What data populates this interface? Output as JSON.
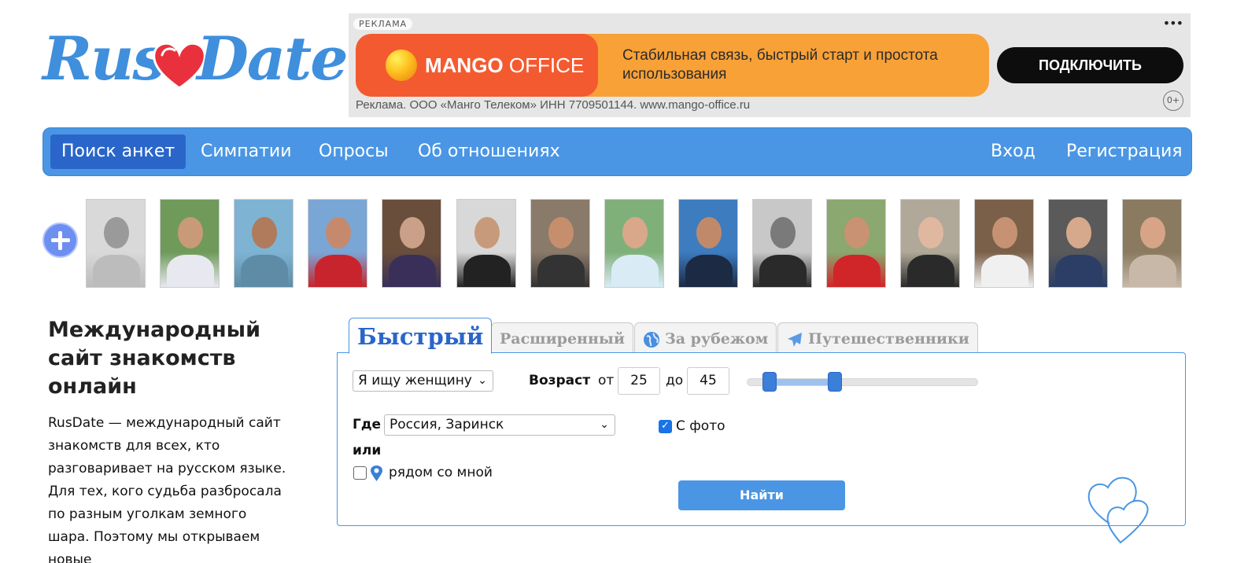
{
  "logo": {
    "part1": "Rus",
    "part2": "Date"
  },
  "ad": {
    "tag": "РЕКЛАМА",
    "menu": "•••",
    "brand_bold": "MANGO",
    "brand_light": " OFFICE",
    "slogan": "Стабильная связь, быстрый старт и простота использования",
    "button": "ПОДКЛЮЧИТЬ",
    "legal": "Реклама. ООО «Манго Телеком» ИНН 7709501144. www.mango-office.ru",
    "age": "0+",
    "colors": {
      "brand": "#f45a30",
      "banner": "#f8a137",
      "button": "#0d0d0d"
    }
  },
  "nav": {
    "items": [
      {
        "label": "Поиск анкет",
        "active": true
      },
      {
        "label": "Симпатии"
      },
      {
        "label": "Опросы"
      },
      {
        "label": "Об отношениях"
      },
      {
        "label": "Вход"
      },
      {
        "label": "Регистрация"
      }
    ],
    "color": "#4a96e4",
    "active_color": "#2a66c9"
  },
  "photos": {
    "add_icon": "plus-icon",
    "count": 15
  },
  "intro": {
    "title": "Международный сайт знакомств онлайн",
    "text": "RusDate — международный сайт знакомств для всех, кто разговаривает на русском языке. Для тех, кого судьба разбросала по разным уголкам земного шара. Поэтому мы открываем новые"
  },
  "tabs": [
    {
      "label": "Быстрый",
      "active": true
    },
    {
      "label": "Расширенный"
    },
    {
      "label": "За рубежом",
      "icon": "globe-icon"
    },
    {
      "label": "Путешественники",
      "icon": "plane-icon"
    }
  ],
  "search": {
    "looking_for": "Я ищу женщину",
    "age_label": "Возраст",
    "from_label": "от",
    "to_label": "до",
    "age_from": "25",
    "age_to": "45",
    "age_range_fraction": [
      0.1,
      0.38
    ],
    "where_label": "Где",
    "location": "Россия, Заринск",
    "or_label": "или",
    "nearby_label": "рядом со мной",
    "nearby_checked": false,
    "with_photo_label": "С фото",
    "with_photo_checked": true,
    "submit": "Найти"
  }
}
